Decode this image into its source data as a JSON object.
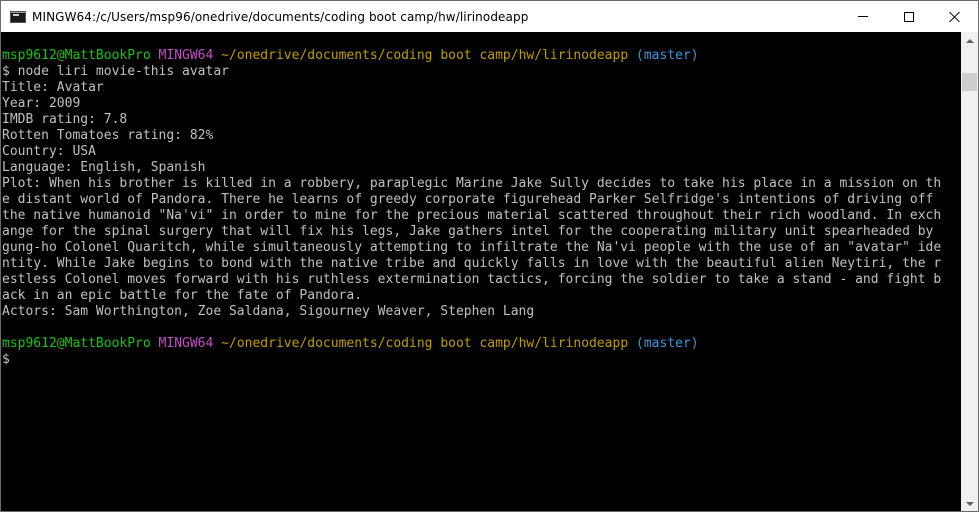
{
  "window": {
    "title": "MINGW64:/c/Users/msp96/onedrive/documents/coding boot camp/hw/lirinodeapp",
    "icon": "terminal-icon"
  },
  "controls": {
    "minimize": "minimize-icon",
    "maximize": "maximize-icon",
    "close": "close-icon"
  },
  "colors": {
    "user_host": "#15c60c",
    "shell": "#c34dc4",
    "path": "#c19c00",
    "branch": "#3a96dd",
    "text": "#c0c0c0",
    "background": "#000000"
  },
  "prompt1": {
    "user_host": "msp9612@MattBookPro",
    "shell": "MINGW64",
    "path": "~/onedrive/documents/coding boot camp/hw/lirinodeapp",
    "branch": "(master)"
  },
  "command": "$ node liri movie-this avatar",
  "output": [
    "Title: Avatar",
    "Year: 2009",
    "IMDB rating: 7.8",
    "Rotten Tomatoes rating: 82%",
    "Country: USA",
    "Language: English, Spanish",
    "Plot: When his brother is killed in a robbery, paraplegic Marine Jake Sully decides to take his place in a mission on th",
    "e distant world of Pandora. There he learns of greedy corporate figurehead Parker Selfridge's intentions of driving off",
    "the native humanoid \"Na'vi\" in order to mine for the precious material scattered throughout their rich woodland. In exch",
    "ange for the spinal surgery that will fix his legs, Jake gathers intel for the cooperating military unit spearheaded by",
    "gung-ho Colonel Quaritch, while simultaneously attempting to infiltrate the Na'vi people with the use of an \"avatar\" ide",
    "ntity. While Jake begins to bond with the native tribe and quickly falls in love with the beautiful alien Neytiri, the r",
    "estless Colonel moves forward with his ruthless extermination tactics, forcing the soldier to take a stand - and fight b",
    "ack in an epic battle for the fate of Pandora.",
    "Actors: Sam Worthington, Zoe Saldana, Sigourney Weaver, Stephen Lang"
  ],
  "prompt2": {
    "user_host": "msp9612@MattBookPro",
    "shell": "MINGW64",
    "path": "~/onedrive/documents/coding boot camp/hw/lirinodeapp",
    "branch": "(master)"
  },
  "cursor_prompt": "$"
}
